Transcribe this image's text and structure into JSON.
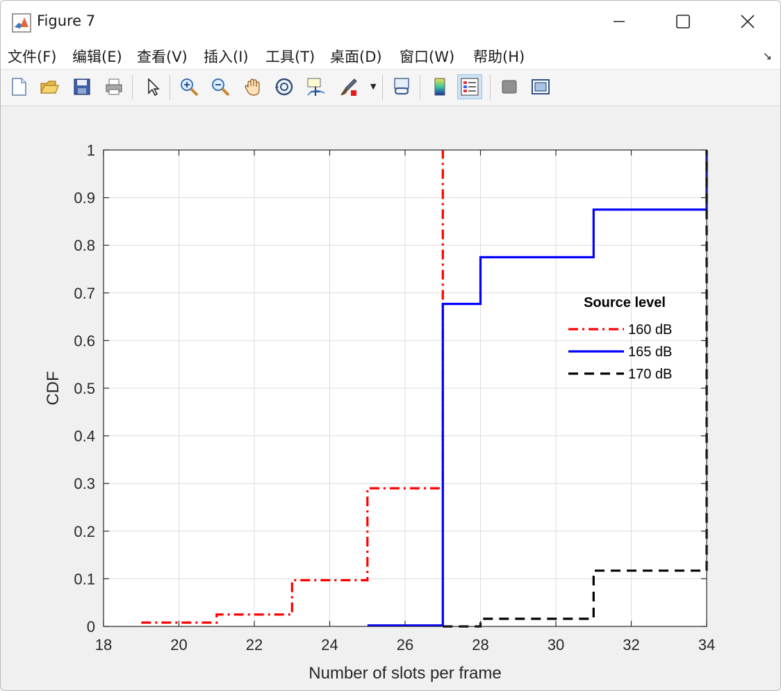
{
  "window": {
    "title": "Figure 7"
  },
  "menu": [
    {
      "label": "文件(F)",
      "name": "menu-file"
    },
    {
      "label": "编辑(E)",
      "name": "menu-edit"
    },
    {
      "label": "查看(V)",
      "name": "menu-view"
    },
    {
      "label": "插入(I)",
      "name": "menu-insert"
    },
    {
      "label": "工具(T)",
      "name": "menu-tools"
    },
    {
      "label": "桌面(D)",
      "name": "menu-desktop"
    },
    {
      "label": "窗口(W)",
      "name": "menu-window"
    },
    {
      "label": "帮助(H)",
      "name": "menu-help"
    }
  ],
  "toolbar": [
    {
      "icon": "new-figure-icon"
    },
    {
      "icon": "open-file-icon"
    },
    {
      "icon": "save-icon"
    },
    {
      "icon": "print-icon"
    },
    {
      "icon": "pointer-icon"
    },
    {
      "icon": "zoom-in-icon"
    },
    {
      "icon": "zoom-out-icon"
    },
    {
      "icon": "pan-hand-icon"
    },
    {
      "icon": "rotate-3d-icon"
    },
    {
      "icon": "data-cursor-icon"
    },
    {
      "icon": "brush-icon"
    },
    {
      "icon": "link-plot-icon"
    },
    {
      "icon": "colorbar-icon"
    },
    {
      "icon": "legend-icon"
    },
    {
      "icon": "hide-plot-tools-icon"
    },
    {
      "icon": "show-plot-tools-icon"
    }
  ],
  "chart_data": {
    "type": "line",
    "title": "",
    "xlabel": "Number of slots per frame",
    "ylabel": "CDF",
    "xlim": [
      18,
      34
    ],
    "ylim": [
      0,
      1
    ],
    "xticks": [
      18,
      20,
      22,
      24,
      26,
      28,
      30,
      32,
      34
    ],
    "yticks": [
      0,
      0.1,
      0.2,
      0.3,
      0.4,
      0.5,
      0.6,
      0.7,
      0.8,
      0.9,
      1
    ],
    "ytick_labels": [
      "0",
      "0.1",
      "0.2",
      "0.3",
      "0.4",
      "0.5",
      "0.6",
      "0.7",
      "0.8",
      "0.9",
      "1"
    ],
    "grid": true,
    "legend": {
      "title": "Source level",
      "placement": "right, middle"
    },
    "series": [
      {
        "name": "160 dB",
        "color": "#ff0000",
        "style": "dash-dot",
        "step": true,
        "x": [
          19,
          21,
          23,
          25,
          27,
          27
        ],
        "y": [
          0.008,
          0.025,
          0.097,
          0.29,
          0.29,
          1.0
        ]
      },
      {
        "name": "165 dB",
        "color": "#0000ff",
        "style": "solid",
        "step": true,
        "x": [
          25,
          27,
          28,
          31,
          34,
          34
        ],
        "y": [
          0.002,
          0.677,
          0.775,
          0.875,
          0.875,
          1.0
        ]
      },
      {
        "name": "170 dB",
        "color": "#000000",
        "style": "dashed",
        "step": true,
        "x": [
          27,
          28,
          31,
          34,
          34
        ],
        "y": [
          0.0,
          0.016,
          0.117,
          0.117,
          1.0
        ]
      }
    ]
  }
}
